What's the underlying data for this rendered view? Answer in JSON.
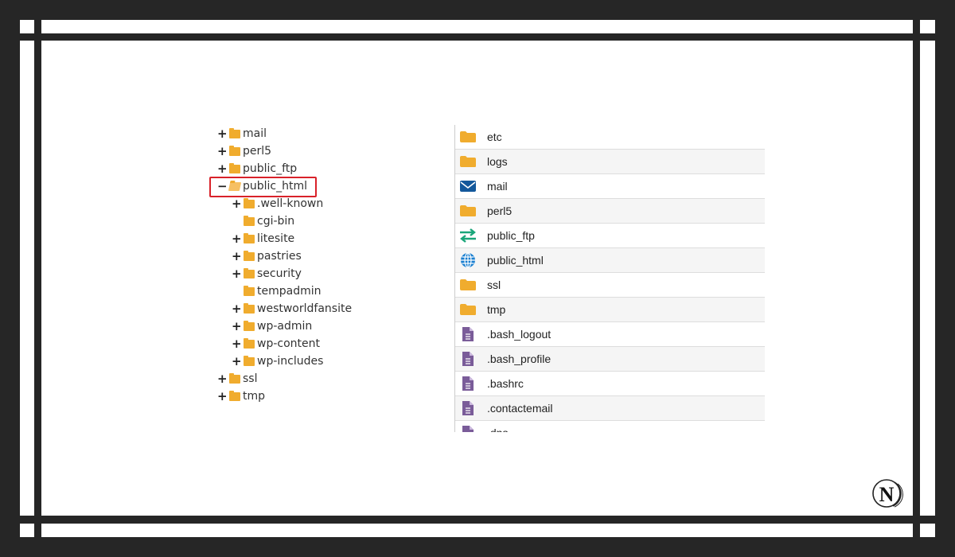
{
  "tree": {
    "items": [
      {
        "label": "mail",
        "level": 0,
        "toggle": "+",
        "expanded": false
      },
      {
        "label": "perl5",
        "level": 0,
        "toggle": "+",
        "expanded": false
      },
      {
        "label": "public_ftp",
        "level": 0,
        "toggle": "+",
        "expanded": false
      },
      {
        "label": "public_html",
        "level": 0,
        "toggle": "−",
        "expanded": true,
        "selected": true
      },
      {
        "label": ".well-known",
        "level": 1,
        "toggle": "+"
      },
      {
        "label": "cgi-bin",
        "level": 1,
        "toggle": ""
      },
      {
        "label": "litesite",
        "level": 1,
        "toggle": "+"
      },
      {
        "label": "pastries",
        "level": 1,
        "toggle": "+"
      },
      {
        "label": "security",
        "level": 1,
        "toggle": "+"
      },
      {
        "label": "tempadmin",
        "level": 1,
        "toggle": ""
      },
      {
        "label": "westworldfansite",
        "level": 1,
        "toggle": "+"
      },
      {
        "label": "wp-admin",
        "level": 1,
        "toggle": "+"
      },
      {
        "label": "wp-content",
        "level": 1,
        "toggle": "+"
      },
      {
        "label": "wp-includes",
        "level": 1,
        "toggle": "+"
      },
      {
        "label": "ssl",
        "level": 0,
        "toggle": "+"
      },
      {
        "label": "tmp",
        "level": 0,
        "toggle": "+"
      }
    ]
  },
  "files": {
    "items": [
      {
        "name": "etc",
        "icon": "folder-icon"
      },
      {
        "name": "logs",
        "icon": "folder-icon"
      },
      {
        "name": "mail",
        "icon": "mail-icon"
      },
      {
        "name": "perl5",
        "icon": "folder-icon"
      },
      {
        "name": "public_ftp",
        "icon": "transfer-arrows-icon"
      },
      {
        "name": "public_html",
        "icon": "globe-icon"
      },
      {
        "name": "ssl",
        "icon": "folder-icon"
      },
      {
        "name": "tmp",
        "icon": "folder-icon"
      },
      {
        "name": ".bash_logout",
        "icon": "text-file-icon"
      },
      {
        "name": ".bash_profile",
        "icon": "text-file-icon"
      },
      {
        "name": ".bashrc",
        "icon": "text-file-icon"
      },
      {
        "name": ".contactemail",
        "icon": "text-file-icon"
      },
      {
        "name": ".dns",
        "icon": "text-file-icon"
      }
    ]
  },
  "colors": {
    "folder": "#f0ac2e",
    "mail": "#13589b",
    "ftp": "#1aa67a",
    "globe": "#1a7fd0",
    "file": "#7a5c99",
    "highlight": "#d9222a",
    "frame": "#262626"
  },
  "logo": {
    "text": "N"
  }
}
